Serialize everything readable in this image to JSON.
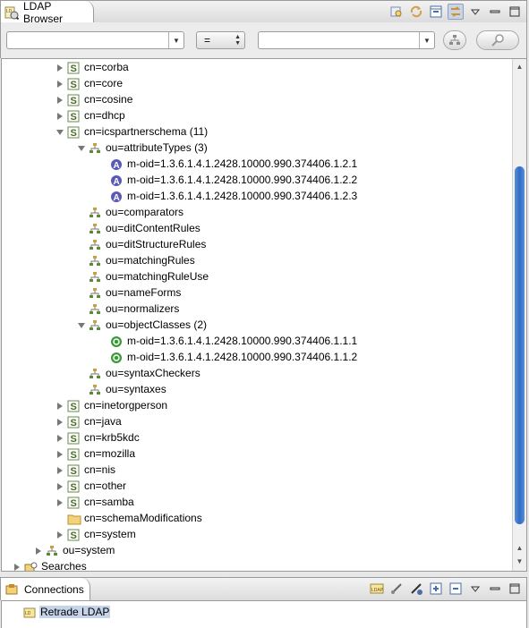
{
  "browser_panel": {
    "tab_title": "LDAP Browser",
    "toolbar_icons": [
      "link-with-editor-icon",
      "refresh-icon",
      "collapse-all-icon",
      "link-icon",
      "view-menu-icon",
      "minimize-icon",
      "maximize-icon"
    ]
  },
  "filter_bar": {
    "attribute_value": "",
    "operator_value": "=",
    "filter_value": ""
  },
  "tree": {
    "rows": [
      {
        "label": "cn=corba",
        "level": 3,
        "twisty": "collapsed",
        "icon": "schema-icon"
      },
      {
        "label": "cn=core",
        "level": 3,
        "twisty": "collapsed",
        "icon": "schema-icon"
      },
      {
        "label": "cn=cosine",
        "level": 3,
        "twisty": "collapsed",
        "icon": "schema-icon"
      },
      {
        "label": "cn=dhcp",
        "level": 3,
        "twisty": "collapsed",
        "icon": "schema-icon"
      },
      {
        "label": "cn=icspartnerschema (11)",
        "level": 3,
        "twisty": "expanded",
        "icon": "schema-icon"
      },
      {
        "label": "ou=attributeTypes (3)",
        "level": 4,
        "twisty": "expanded",
        "icon": "ou-icon"
      },
      {
        "label": "m-oid=1.3.6.1.4.1.2428.10000.990.374406.1.2.1",
        "level": 5,
        "twisty": "none",
        "icon": "attribute-icon"
      },
      {
        "label": "m-oid=1.3.6.1.4.1.2428.10000.990.374406.1.2.2",
        "level": 5,
        "twisty": "none",
        "icon": "attribute-icon"
      },
      {
        "label": "m-oid=1.3.6.1.4.1.2428.10000.990.374406.1.2.3",
        "level": 5,
        "twisty": "none",
        "icon": "attribute-icon"
      },
      {
        "label": "ou=comparators",
        "level": 4,
        "twisty": "none",
        "icon": "ou-icon"
      },
      {
        "label": "ou=ditContentRules",
        "level": 4,
        "twisty": "none",
        "icon": "ou-icon"
      },
      {
        "label": "ou=ditStructureRules",
        "level": 4,
        "twisty": "none",
        "icon": "ou-icon"
      },
      {
        "label": "ou=matchingRules",
        "level": 4,
        "twisty": "none",
        "icon": "ou-icon"
      },
      {
        "label": "ou=matchingRuleUse",
        "level": 4,
        "twisty": "none",
        "icon": "ou-icon"
      },
      {
        "label": "ou=nameForms",
        "level": 4,
        "twisty": "none",
        "icon": "ou-icon"
      },
      {
        "label": "ou=normalizers",
        "level": 4,
        "twisty": "none",
        "icon": "ou-icon"
      },
      {
        "label": "ou=objectClasses (2)",
        "level": 4,
        "twisty": "expanded",
        "icon": "ou-icon"
      },
      {
        "label": "m-oid=1.3.6.1.4.1.2428.10000.990.374406.1.1.1",
        "level": 5,
        "twisty": "none",
        "icon": "objectclass-icon"
      },
      {
        "label": "m-oid=1.3.6.1.4.1.2428.10000.990.374406.1.1.2",
        "level": 5,
        "twisty": "none",
        "icon": "objectclass-icon"
      },
      {
        "label": "ou=syntaxCheckers",
        "level": 4,
        "twisty": "none",
        "icon": "ou-icon"
      },
      {
        "label": "ou=syntaxes",
        "level": 4,
        "twisty": "none",
        "icon": "ou-icon"
      },
      {
        "label": "cn=inetorgperson",
        "level": 3,
        "twisty": "collapsed",
        "icon": "schema-icon"
      },
      {
        "label": "cn=java",
        "level": 3,
        "twisty": "collapsed",
        "icon": "schema-icon"
      },
      {
        "label": "cn=krb5kdc",
        "level": 3,
        "twisty": "collapsed",
        "icon": "schema-icon"
      },
      {
        "label": "cn=mozilla",
        "level": 3,
        "twisty": "collapsed",
        "icon": "schema-icon"
      },
      {
        "label": "cn=nis",
        "level": 3,
        "twisty": "collapsed",
        "icon": "schema-icon"
      },
      {
        "label": "cn=other",
        "level": 3,
        "twisty": "collapsed",
        "icon": "schema-icon"
      },
      {
        "label": "cn=samba",
        "level": 3,
        "twisty": "collapsed",
        "icon": "schema-icon"
      },
      {
        "label": "cn=schemaModifications",
        "level": 3,
        "twisty": "none",
        "icon": "folder-icon"
      },
      {
        "label": "cn=system",
        "level": 3,
        "twisty": "collapsed",
        "icon": "schema-icon"
      },
      {
        "label": "ou=system",
        "level": 2,
        "twisty": "collapsed",
        "icon": "ou-icon"
      },
      {
        "label": "Searches",
        "level": 1,
        "twisty": "collapsed",
        "icon": "searches-icon"
      }
    ]
  },
  "connections_panel": {
    "tab_title": "Connections",
    "toolbar_icons": [
      "ldap-new-connection-icon",
      "open-connection-icon",
      "close-connection-icon",
      "expand-all-icon",
      "collapse-all-icon",
      "view-menu-icon",
      "minimize-icon",
      "maximize-icon"
    ],
    "items": [
      {
        "label": "Retrade LDAP",
        "selected": true
      }
    ]
  },
  "colors": {
    "selection": "#c5d4ea",
    "scroll_thumb": "#2f6cc4",
    "attribute_icon": "#5b59b8",
    "objectclass_icon": "#3a9a3a",
    "schema_icon": "#5a7d3c"
  }
}
